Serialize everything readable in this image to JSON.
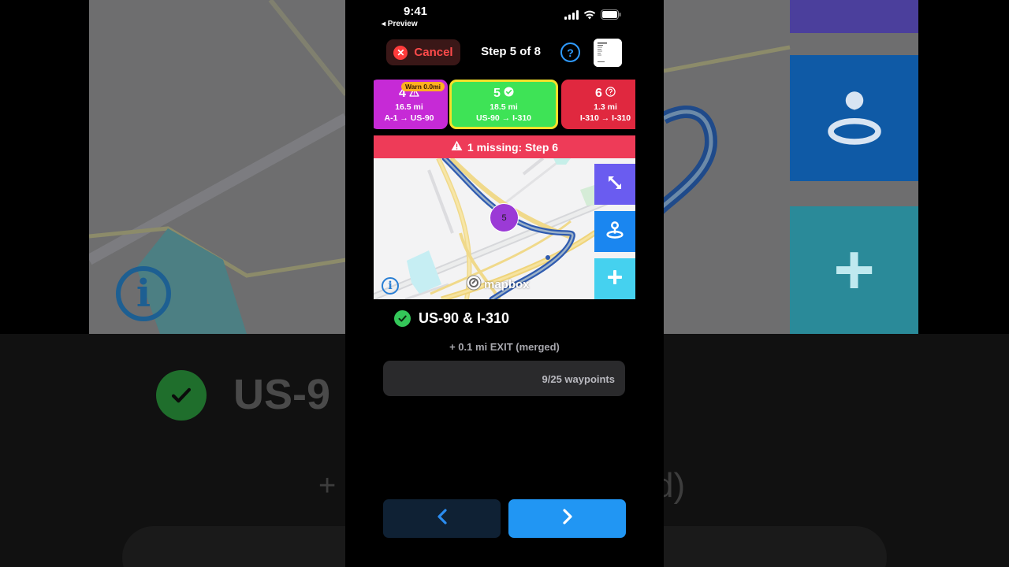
{
  "status": {
    "time": "9:41",
    "back_label": "◂ Preview"
  },
  "header": {
    "cancel_label": "Cancel",
    "step_title": "Step 5 of 8",
    "help_glyph": "?"
  },
  "steps": [
    {
      "number": "4",
      "distance": "16.5 mi",
      "route": "A-1 → US-90",
      "badge": "Warn 0.0mi",
      "state": "warning",
      "color": "#c62ad6"
    },
    {
      "number": "5",
      "distance": "18.5 mi",
      "route": "US-90 → I-310",
      "state": "complete",
      "color": "#3ee356"
    },
    {
      "number": "6",
      "distance": "1.3 mi",
      "route": "I-310 → I-310",
      "state": "missing",
      "color": "#e0283f"
    }
  ],
  "alert": {
    "text": "1 missing: Step 6"
  },
  "map": {
    "marker_label": "5",
    "attribution": "mapbox",
    "info_glyph": "i"
  },
  "location": {
    "title": "US-90 & I-310",
    "detail": "+ 0.1 mi EXIT (merged)",
    "waypoints": "9/25 waypoints"
  },
  "colors": {
    "accent": "#2196f3",
    "success": "#34c759",
    "danger": "#ee3b58"
  },
  "backdrop": {
    "title_fragment": "US-9",
    "plus": "+",
    "suffix": "d)"
  }
}
